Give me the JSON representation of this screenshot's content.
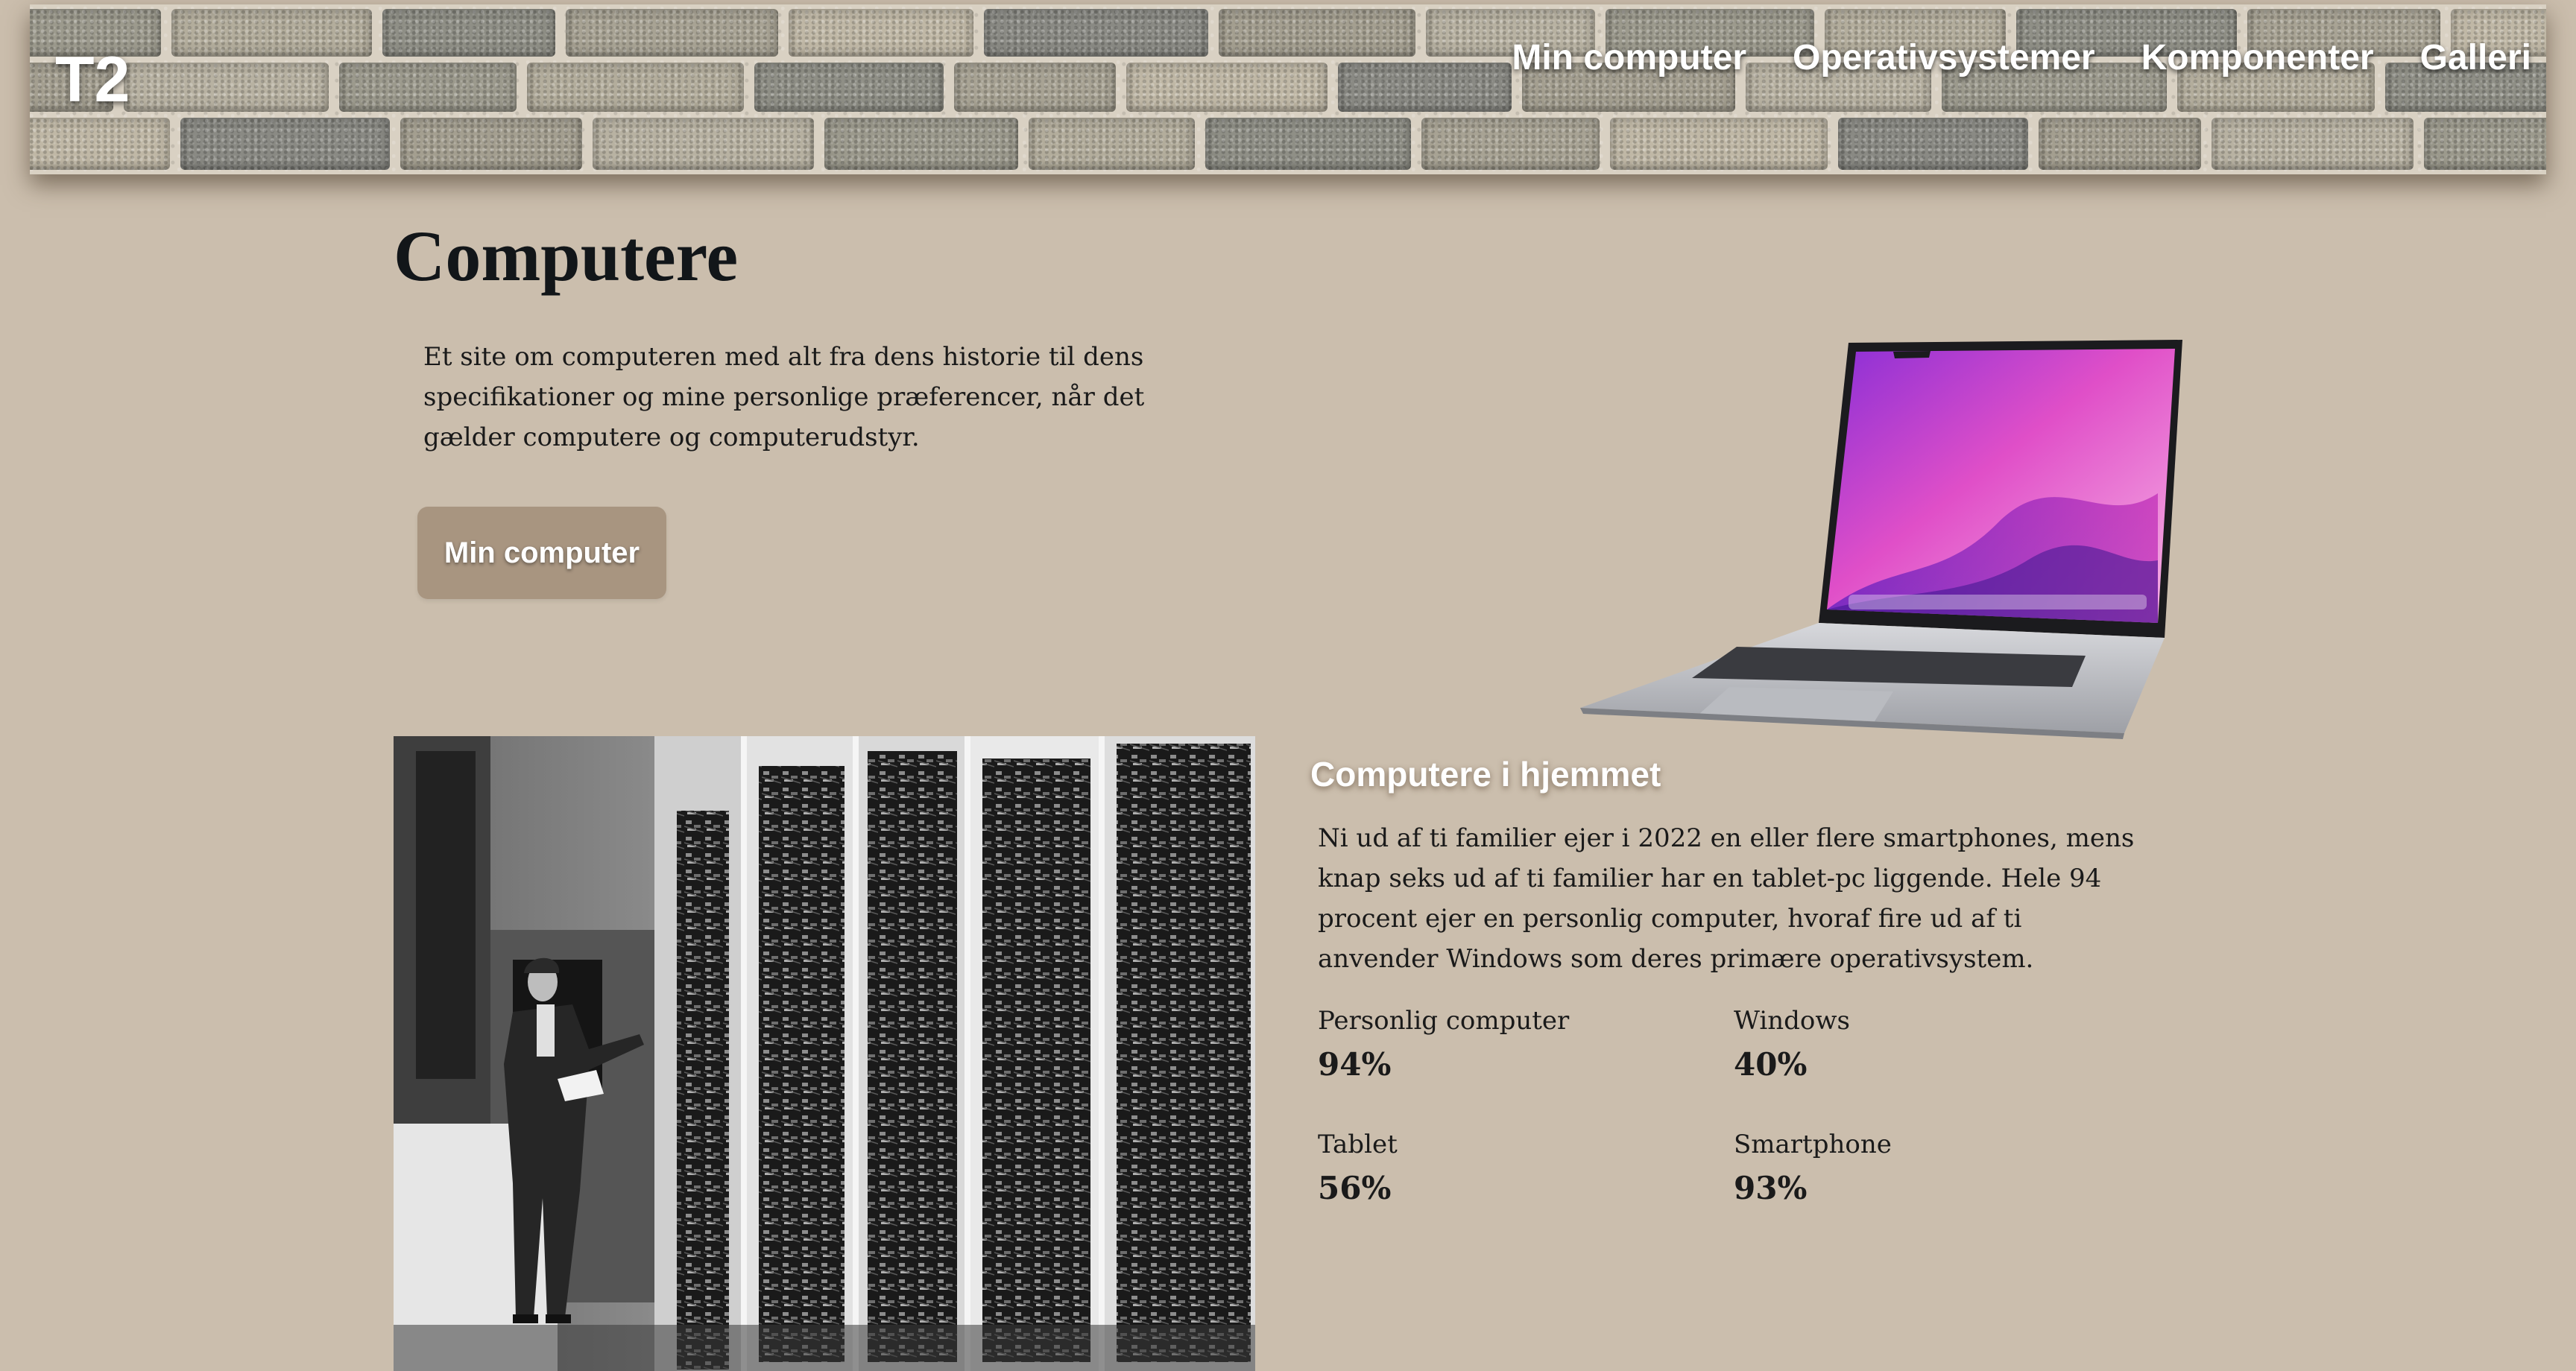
{
  "header": {
    "logo": "T2",
    "nav": [
      "Min computer",
      "Operativsystemer",
      "Komponenter",
      "Galleri"
    ]
  },
  "hero": {
    "title": "Computere",
    "intro": "Et site om computeren med alt fra dens historie til dens specifikationer og mine personlige præferencer, når det gælder computere og computerudstyr.",
    "button": "Min computer"
  },
  "home": {
    "title": "Computere i hjemmet",
    "text": "Ni ud af ti familier ejer i 2022 en eller flere smartphones, mens knap seks ud af ti familier har en tablet-pc liggende. Hele 94 procent ejer en personlig computer, hvoraf fire ud af ti anvender Windows som deres primære operativsystem.",
    "stats": [
      {
        "label": "Personlig computer",
        "value": "94%"
      },
      {
        "label": "Windows",
        "value": "40%"
      },
      {
        "label": "Tablet",
        "value": "56%"
      },
      {
        "label": "Smartphone",
        "value": "93%"
      }
    ]
  },
  "colors": {
    "background": "#cbbead",
    "button": "#a89580",
    "title": "#121619"
  }
}
